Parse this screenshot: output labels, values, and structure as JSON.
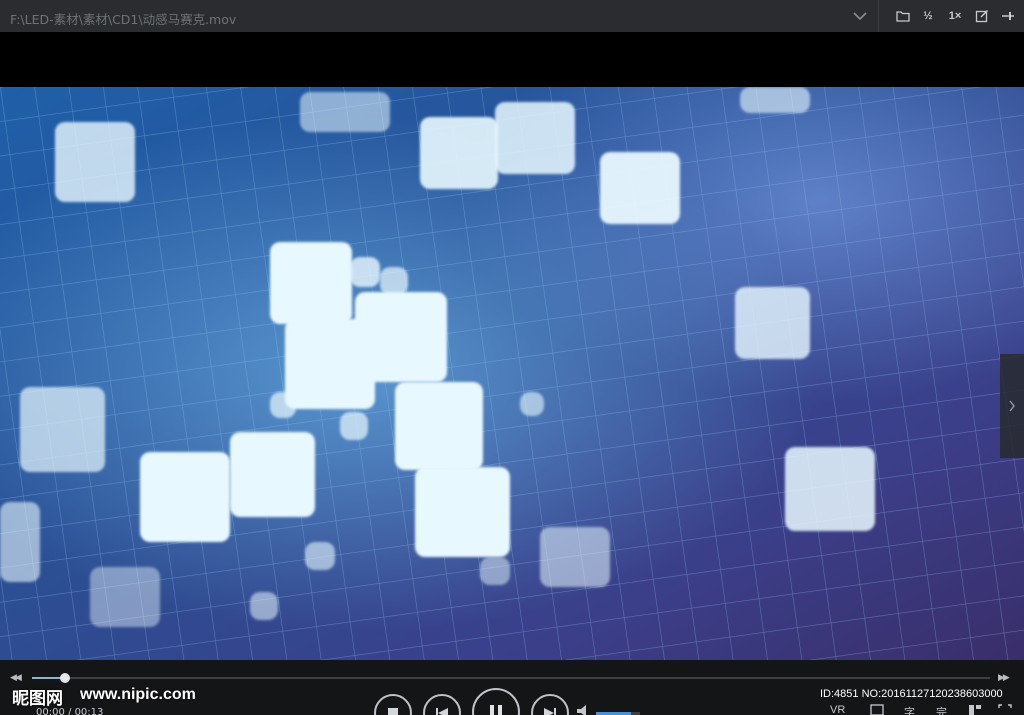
{
  "window": {
    "title": "F:\\LED-素材\\素材\\CD1\\动感马赛克.mov",
    "toolbar": {
      "open_folder": "folder-icon",
      "half_size_label": "½",
      "speed_label": "1×",
      "pin": "pin-icon"
    }
  },
  "playback": {
    "current_time": "00:00",
    "total_time": "00:13",
    "time_separator": " / ",
    "progress_fraction": 0.034,
    "volume_fraction": 0.8
  },
  "controls": {
    "vr_label": "VR",
    "subtitle_label": "字",
    "completion_label": "完"
  },
  "watermark": {
    "logo": "昵图网",
    "url": "www.nipic.com",
    "id_text": "ID:4851 NO:20161127120238603000"
  },
  "colors": {
    "titlebar_bg": "#2a2c30",
    "controls_bg": "#141517",
    "accent": "#4a90d9"
  }
}
